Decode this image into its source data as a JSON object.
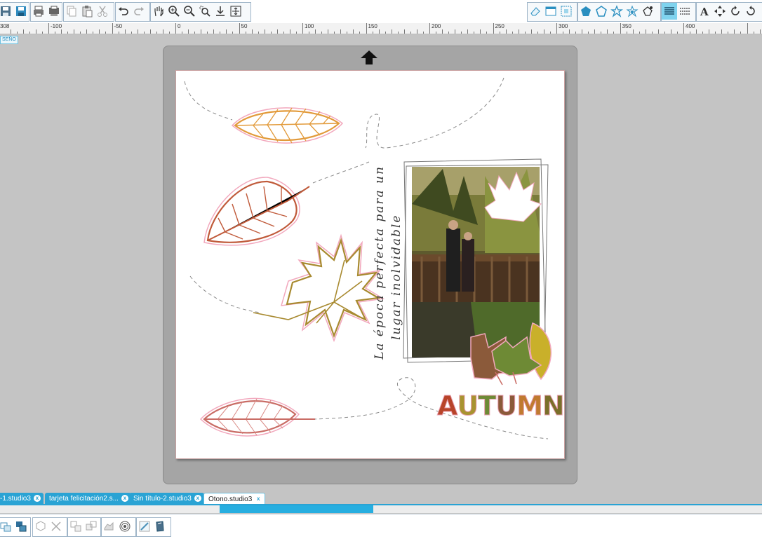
{
  "toolbar": {
    "left_icons": [
      "save-icon",
      "save-library-icon",
      "print-icon",
      "send-icon",
      "copy-icon",
      "paste-icon",
      "cut-icon",
      "undo-icon",
      "redo-icon",
      "pan-hand-icon",
      "zoom-in-icon",
      "zoom-out-icon",
      "zoom-select-icon",
      "move-down-icon",
      "fit-page-icon"
    ],
    "right_icons": [
      "eraser-icon",
      "page-setup-icon",
      "registration-icon",
      "fill-icon",
      "line-style-icon",
      "offset-icon",
      "trace-icon",
      "replicate-icon",
      "cut-settings-icon",
      "send-panel-icon",
      "text-icon",
      "align-icon",
      "transform-icon"
    ],
    "active_icon": "cut-settings-icon"
  },
  "ruler": {
    "labels": [
      "-100",
      "-50",
      "0",
      "50",
      "100",
      "150",
      "200",
      "250",
      "300",
      "350",
      "400"
    ],
    "edge_label": "308"
  },
  "design_badge": "SEÑO",
  "canvas": {
    "script_line_1": "La época perfecta para un",
    "script_line_2": "lugar inolvidable",
    "title_word": "AUTUMN",
    "title_colors": [
      "#b8442a",
      "#a89330",
      "#6e8a35",
      "#8b5a3a",
      "#c07a30",
      "#7a6f2a"
    ]
  },
  "tabs": [
    {
      "label": "-1.studio3",
      "active": false
    },
    {
      "label": "tarjeta felicitación2.s...",
      "active": false
    },
    {
      "label": "Sin título-2.studio3",
      "active": false
    },
    {
      "label": "Otono.studio3",
      "active": true
    }
  ],
  "tab_close": "x",
  "bottom_icons": [
    "group-icon",
    "ungroup-icon",
    "make-compound-icon",
    "release-compound-icon",
    "duplicate-icon",
    "mirror-icon",
    "weld-icon",
    "offset-ring-icon",
    "trace-pen-icon",
    "sketch-icon"
  ]
}
